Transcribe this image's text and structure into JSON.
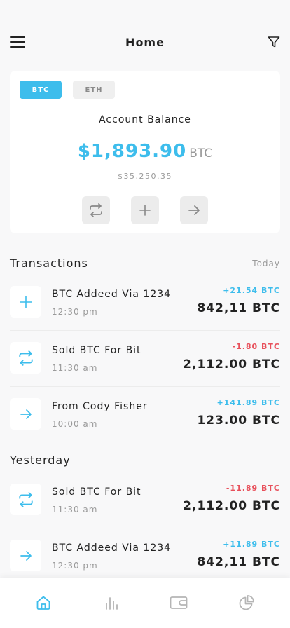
{
  "header": {
    "title": "Home"
  },
  "balance_card": {
    "tabs": [
      {
        "label": "BTC",
        "active": true
      },
      {
        "label": "ETH",
        "active": false
      }
    ],
    "label": "Account Balance",
    "amount": "$1,893.90",
    "currency": "BTC",
    "usd_value": "$35,250.35",
    "actions": [
      {
        "icon": "swap-icon"
      },
      {
        "icon": "plus-icon"
      },
      {
        "icon": "arrow-right-icon"
      }
    ]
  },
  "transactions": {
    "title": "Transactions",
    "date_label": "Today",
    "items": [
      {
        "icon": "plus-icon",
        "name": "BTC Addeed Via 1234",
        "time": "12:30 pm",
        "change": "+21.54 BTC",
        "total": "842,11 BTC"
      },
      {
        "icon": "swap-icon",
        "name": "Sold BTC For Bit",
        "time": "11:30 am",
        "change": "-1.80 BTC",
        "total": "2,112.00 BTC"
      },
      {
        "icon": "arrow-right-icon",
        "name": "From Cody Fisher",
        "time": "10:00 am",
        "change": "+141.89 BTC",
        "total": "123.00 BTC"
      }
    ]
  },
  "yesterday": {
    "title": "Yesterday",
    "items": [
      {
        "icon": "swap-icon",
        "name": "Sold BTC For Bit",
        "time": "11:30 am",
        "change": "-11.89 BTC",
        "total": "2,112.00 BTC"
      },
      {
        "icon": "arrow-right-icon",
        "name": "BTC Addeed Via 1234",
        "time": "12:30 pm",
        "change": "+11.89 BTC",
        "total": "842,11 BTC"
      }
    ]
  },
  "bottom_nav": [
    {
      "icon": "home-icon",
      "active": true
    },
    {
      "icon": "bar-chart-icon",
      "active": false
    },
    {
      "icon": "wallet-icon",
      "active": false
    },
    {
      "icon": "pie-chart-icon",
      "active": false
    }
  ],
  "colors": {
    "accent": "#3dbdec",
    "negative": "#e8505b",
    "background": "#f8f8f9"
  }
}
